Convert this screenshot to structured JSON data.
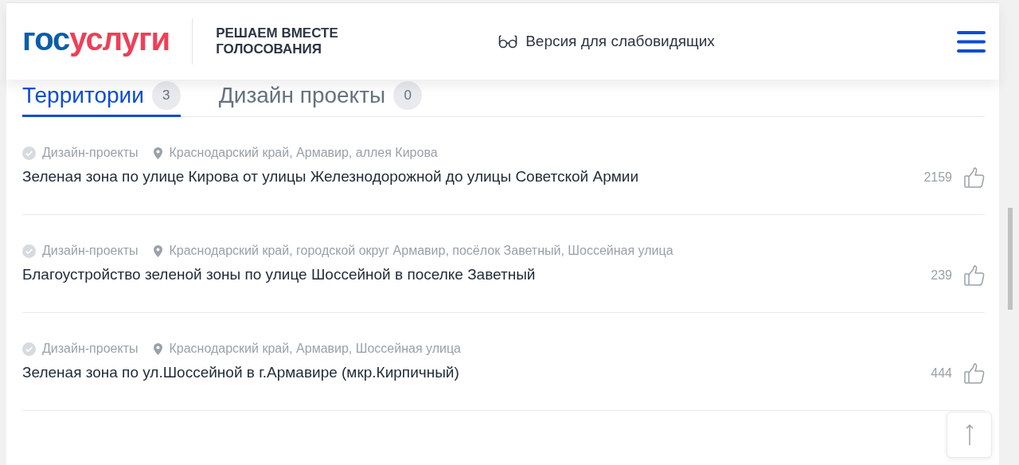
{
  "header": {
    "logo_left": "гос",
    "logo_right": "услуги",
    "subtitle_line_1": "РЕШАЕМ ВМЕСТЕ",
    "subtitle_line_2": "ГОЛОСОВАНИЯ",
    "accessibility_link": "Версия для слабовидящих"
  },
  "tabs": [
    {
      "label": "Территории",
      "count": "3",
      "selected": true
    },
    {
      "label": "Дизайн проекты",
      "count": "0",
      "selected": false
    }
  ],
  "projects": [
    {
      "category": "Дизайн-проекты",
      "address": "Краснодарский край, Армавир, аллея Кирова",
      "title": "Зеленая зона по улице Кирова от улицы Железнодорожной до улицы Советской Армии",
      "votes": "2159"
    },
    {
      "category": "Дизайн-проекты",
      "address": "Краснодарский край, городской округ Армавир, посёлок Заветный, Шоссейная улица",
      "title": "Благоустройство зеленой зоны по улице Шоссейной в поселке Заветный",
      "votes": "239"
    },
    {
      "category": "Дизайн-проекты",
      "address": "Краснодарский край, Армавир, Шоссейная улица",
      "title": "Зеленая зона по ул.Шоссейной в г.Армавире (мкр.Кирпичный)",
      "votes": "444"
    }
  ]
}
